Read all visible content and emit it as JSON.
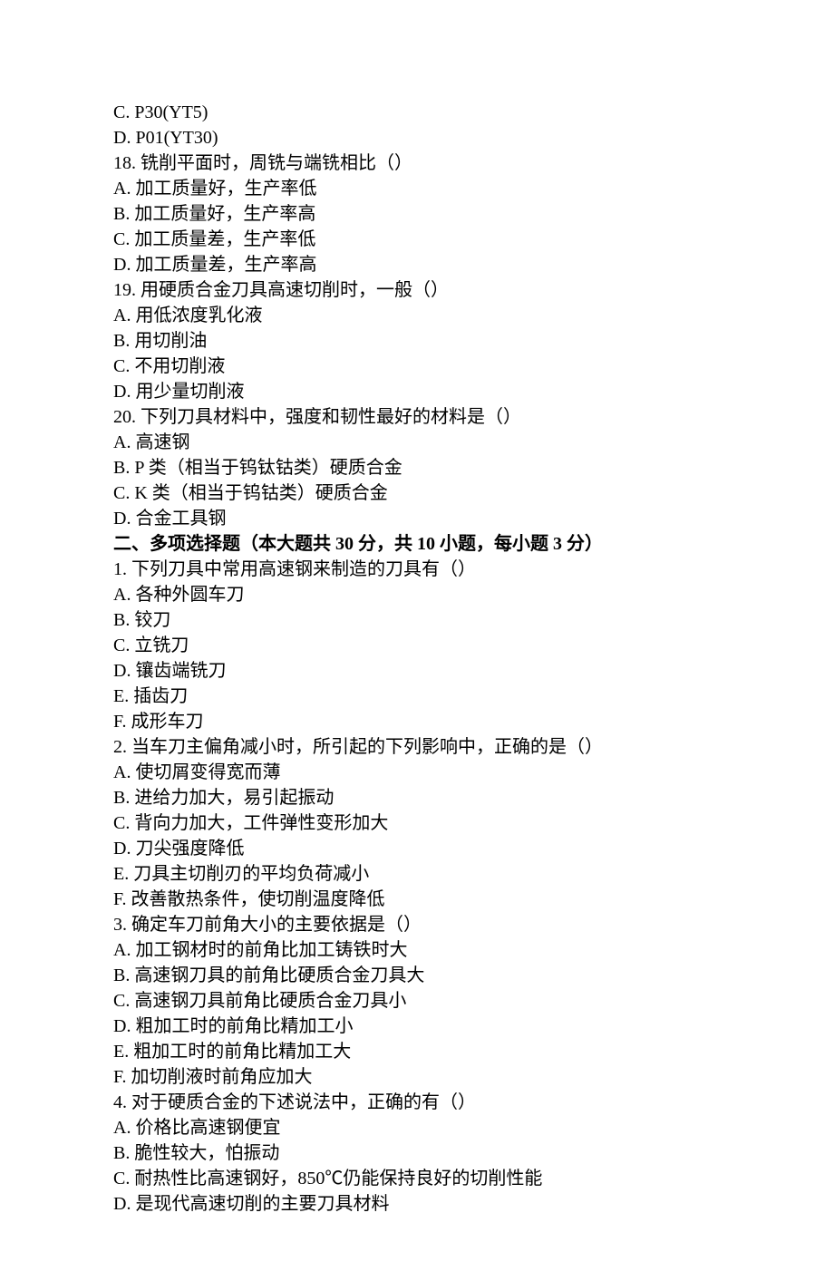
{
  "lines": [
    {
      "text": "C. P30(YT5)",
      "bold": false,
      "name": "q17-option-c"
    },
    {
      "text": "D. P01(YT30)",
      "bold": false,
      "name": "q17-option-d"
    },
    {
      "text": "18. 铣削平面时，周铣与端铣相比（）",
      "bold": false,
      "name": "q18-stem"
    },
    {
      "text": "A. 加工质量好，生产率低",
      "bold": false,
      "name": "q18-option-a"
    },
    {
      "text": "B. 加工质量好，生产率高",
      "bold": false,
      "name": "q18-option-b"
    },
    {
      "text": "C. 加工质量差，生产率低",
      "bold": false,
      "name": "q18-option-c"
    },
    {
      "text": "D. 加工质量差，生产率高",
      "bold": false,
      "name": "q18-option-d"
    },
    {
      "text": "19. 用硬质合金刀具高速切削时，一般（）",
      "bold": false,
      "name": "q19-stem"
    },
    {
      "text": "A. 用低浓度乳化液",
      "bold": false,
      "name": "q19-option-a"
    },
    {
      "text": "B. 用切削油",
      "bold": false,
      "name": "q19-option-b"
    },
    {
      "text": "C. 不用切削液",
      "bold": false,
      "name": "q19-option-c"
    },
    {
      "text": "D. 用少量切削液",
      "bold": false,
      "name": "q19-option-d"
    },
    {
      "text": "20. 下列刀具材料中，强度和韧性最好的材料是（）",
      "bold": false,
      "name": "q20-stem"
    },
    {
      "text": "A. 高速钢",
      "bold": false,
      "name": "q20-option-a"
    },
    {
      "text": "B. P 类（相当于钨钛钴类）硬质合金",
      "bold": false,
      "name": "q20-option-b"
    },
    {
      "text": "C. K 类（相当于钨钴类）硬质合金",
      "bold": false,
      "name": "q20-option-c"
    },
    {
      "text": "D. 合金工具钢",
      "bold": false,
      "name": "q20-option-d"
    },
    {
      "text": "二、多项选择题（本大题共 30 分，共 10 小题，每小题 3 分）",
      "bold": true,
      "name": "section-2-heading"
    },
    {
      "text": "1. 下列刀具中常用高速钢来制造的刀具有（）",
      "bold": false,
      "name": "s2-q1-stem"
    },
    {
      "text": "A. 各种外圆车刀",
      "bold": false,
      "name": "s2-q1-option-a"
    },
    {
      "text": "B. 铰刀",
      "bold": false,
      "name": "s2-q1-option-b"
    },
    {
      "text": "C. 立铣刀",
      "bold": false,
      "name": "s2-q1-option-c"
    },
    {
      "text": "D. 镶齿端铣刀",
      "bold": false,
      "name": "s2-q1-option-d"
    },
    {
      "text": "E. 插齿刀",
      "bold": false,
      "name": "s2-q1-option-e"
    },
    {
      "text": "F. 成形车刀",
      "bold": false,
      "name": "s2-q1-option-f"
    },
    {
      "text": "2. 当车刀主偏角减小时，所引起的下列影响中，正确的是（）",
      "bold": false,
      "name": "s2-q2-stem"
    },
    {
      "text": "A. 使切屑变得宽而薄",
      "bold": false,
      "name": "s2-q2-option-a"
    },
    {
      "text": "B. 进给力加大，易引起振动",
      "bold": false,
      "name": "s2-q2-option-b"
    },
    {
      "text": "C. 背向力加大，工件弹性变形加大",
      "bold": false,
      "name": "s2-q2-option-c"
    },
    {
      "text": "D. 刀尖强度降低",
      "bold": false,
      "name": "s2-q2-option-d"
    },
    {
      "text": "E. 刀具主切削刃的平均负荷减小",
      "bold": false,
      "name": "s2-q2-option-e"
    },
    {
      "text": "F. 改善散热条件，使切削温度降低",
      "bold": false,
      "name": "s2-q2-option-f"
    },
    {
      "text": "3. 确定车刀前角大小的主要依据是（）",
      "bold": false,
      "name": "s2-q3-stem"
    },
    {
      "text": "A. 加工钢材时的前角比加工铸铁时大",
      "bold": false,
      "name": "s2-q3-option-a"
    },
    {
      "text": "B. 高速钢刀具的前角比硬质合金刀具大",
      "bold": false,
      "name": "s2-q3-option-b"
    },
    {
      "text": "C. 高速钢刀具前角比硬质合金刀具小",
      "bold": false,
      "name": "s2-q3-option-c"
    },
    {
      "text": "D. 粗加工时的前角比精加工小",
      "bold": false,
      "name": "s2-q3-option-d"
    },
    {
      "text": "E. 粗加工时的前角比精加工大",
      "bold": false,
      "name": "s2-q3-option-e"
    },
    {
      "text": "F. 加切削液时前角应加大",
      "bold": false,
      "name": "s2-q3-option-f"
    },
    {
      "text": "4. 对于硬质合金的下述说法中，正确的有（）",
      "bold": false,
      "name": "s2-q4-stem"
    },
    {
      "text": "A. 价格比高速钢便宜",
      "bold": false,
      "name": "s2-q4-option-a"
    },
    {
      "text": "B. 脆性较大，怕振动",
      "bold": false,
      "name": "s2-q4-option-b"
    },
    {
      "text": "C. 耐热性比高速钢好，850℃仍能保持良好的切削性能",
      "bold": false,
      "name": "s2-q4-option-c"
    },
    {
      "text": "D. 是现代高速切削的主要刀具材料",
      "bold": false,
      "name": "s2-q4-option-d"
    }
  ]
}
